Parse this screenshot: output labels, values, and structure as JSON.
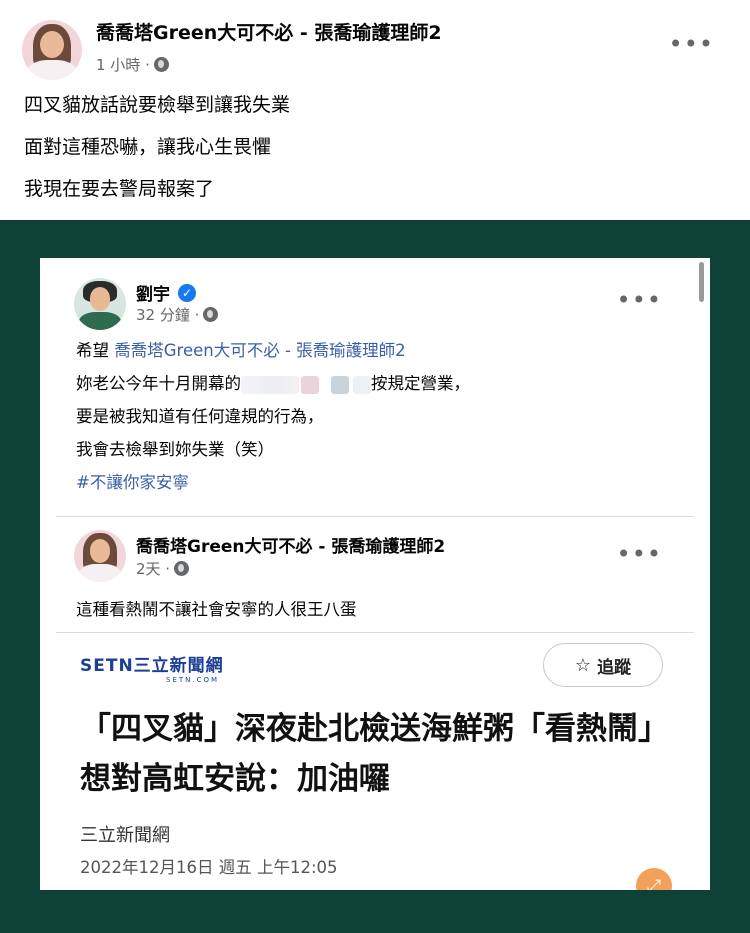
{
  "post": {
    "author": "喬喬塔Green大可不必 - 張喬瑜護理師2",
    "time": "1 小時 ·",
    "lines": [
      "四叉貓放話說要檢舉到讓我失業",
      "面對這種恐嚇，讓我心生畏懼",
      "我現在要去警局報案了"
    ]
  },
  "screenshot": {
    "comment1": {
      "author": "劉宇",
      "time": "32 分鐘 ·",
      "prefix": "希望",
      "mention": "喬喬塔Green大可不必 - 張喬瑜護理師2",
      "line1_start": "妳老公今年十月開幕的",
      "line1_end": "按規定營業，",
      "line2": "要是被我知道有任何違規的行為，",
      "line3": "我會去檢舉到妳失業（笑）",
      "hashtag": "#不讓你家安寧"
    },
    "comment2": {
      "author": "喬喬塔Green大可不必 - 張喬瑜護理師2",
      "time": "2天 ·",
      "text": "這種看熱鬧不讓社會安寧的人很王八蛋"
    },
    "news": {
      "logo": "SETN三立新聞網",
      "logo_sub": "SETN.COM",
      "follow_label": "追蹤",
      "headline": "「四叉貓」深夜赴北檢送海鮮粥「看熱鬧」 想對高虹安說：加油囉",
      "source": "三立新聞網",
      "date": "2022年12月16日 週五 上午12:05"
    }
  },
  "icons": {
    "more": "more-options-icon",
    "globe": "globe-icon",
    "verified": "verified-badge-icon",
    "star": "star-icon",
    "share": "share-icon"
  },
  "colors": {
    "frame": "#0f4236",
    "link": "#3b5ea8",
    "verified": "#1877f2",
    "logo": "#1c3f94"
  }
}
